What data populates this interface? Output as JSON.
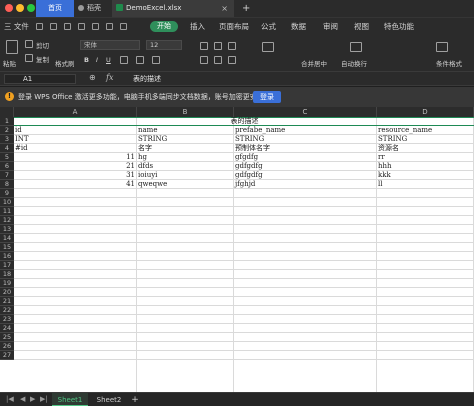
{
  "titlebar": {
    "tabs": [
      {
        "label": "首页"
      },
      {
        "label": "稻壳"
      },
      {
        "label": "DemoExcel.xlsx"
      }
    ],
    "new_tab": "+",
    "close_tab": "×"
  },
  "menubar": {
    "file_label": "三 文件",
    "start_label": "开始",
    "items": [
      "插入",
      "页面布局",
      "公式",
      "数据",
      "审阅",
      "视图",
      "特色功能"
    ]
  },
  "ribbon": {
    "cut_label": "剪切",
    "copy_label": "复制",
    "paste_label": "粘贴",
    "format_painter_label": "格式刷",
    "font_name": "宋体",
    "font_size": "12",
    "merge_label": "合并居中",
    "wrap_label": "自动换行",
    "cond_format_label": "条件格式"
  },
  "formula_bar": {
    "cell_ref": "A1",
    "fx": "fx",
    "content": "表的描述"
  },
  "notice": {
    "message": "登录 WPS Office 激活更多功能，电脑手机多端同步文档数据，账号加密更安全。",
    "login_label": "登录"
  },
  "grid": {
    "columns": [
      "A",
      "B",
      "C",
      "D"
    ],
    "rows": [
      "1",
      "2",
      "3",
      "4",
      "5",
      "6",
      "7",
      "8",
      "9",
      "10",
      "11",
      "12",
      "13",
      "14",
      "15",
      "16",
      "17",
      "18",
      "19",
      "20",
      "21",
      "22",
      "23",
      "24",
      "25",
      "26",
      "27"
    ],
    "merged_title": "表的描述",
    "data": [
      [
        "id",
        "name",
        "prefabe_name",
        "resource_name"
      ],
      [
        "INT",
        "STRING",
        "STRING",
        "STRING"
      ],
      [
        "#id",
        "名字",
        "预制体名字",
        "资源名"
      ],
      [
        "11",
        "hg",
        "gfgdfg",
        "rr"
      ],
      [
        "21",
        "dfds",
        "gdfgdfg",
        "hhh"
      ],
      [
        "31",
        "ioiuyi",
        "gdfgdfg",
        "kkk"
      ],
      [
        "41",
        "qweqwe",
        "jfghjd",
        "ll"
      ]
    ]
  },
  "sheets": {
    "tabs": [
      "Sheet1",
      "Sheet2"
    ],
    "active": "Sheet1",
    "add": "+"
  }
}
